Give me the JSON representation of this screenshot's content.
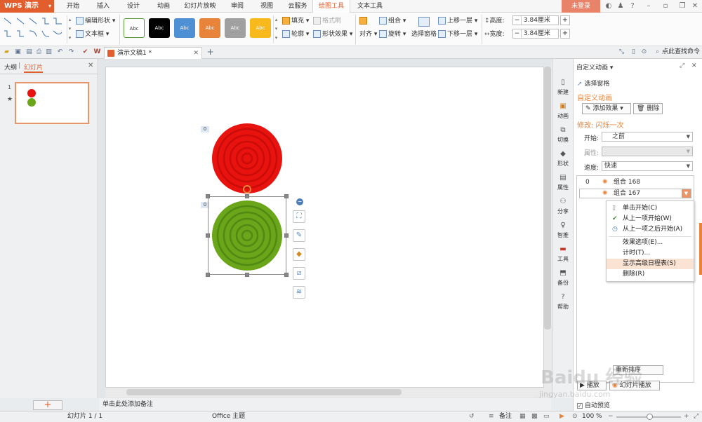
{
  "app": {
    "logo": "WPS 演示",
    "login": "未登录"
  },
  "menu_tabs": [
    "开始",
    "插入",
    "设计",
    "动画",
    "幻灯片放映",
    "审阅",
    "视图",
    "云服务",
    "绘图工具",
    "文本工具"
  ],
  "ribbon": {
    "edit_shape": "编辑形状",
    "textbox": "文本框",
    "style_label": "Abc",
    "fill": "填充",
    "format_brush": "格式刷",
    "outline": "轮廓",
    "shape_effect": "形状效果",
    "align": "对齐",
    "group": "组合",
    "rotate": "旋转",
    "selection_pane": "选择窗格",
    "bring_forward": "上移一层",
    "send_backward": "下移一层",
    "height_label": "高度:",
    "height_value": "3.84厘米",
    "width_label": "宽度:",
    "width_value": "3.84厘米",
    "swatch_colors": [
      "#ffffff",
      "#000000",
      "#4f8fd4",
      "#e8843a",
      "#a0a0a0",
      "#f7b91c"
    ]
  },
  "doc_tab": {
    "title": "演示文稿1 *"
  },
  "quick_right": {
    "search": "点此查找命令"
  },
  "left_pane": {
    "tab_outline": "大纲",
    "tab_slides": "幻灯片",
    "slide_number": "1"
  },
  "slide": {
    "shape_tags": [
      "0",
      "0"
    ],
    "red_circle_color": "#e8120f",
    "green_circle_color": "#6aa51a"
  },
  "notes": {
    "placeholder": "单击此处添加备注"
  },
  "icon_strip": [
    {
      "label": "新建",
      "icon": "doc-icon"
    },
    {
      "label": "动画",
      "icon": "animation-icon"
    },
    {
      "label": "切换",
      "icon": "switch-icon"
    },
    {
      "label": "形状",
      "icon": "shape-icon"
    },
    {
      "label": "属性",
      "icon": "property-icon"
    },
    {
      "label": "分享",
      "icon": "share-icon"
    },
    {
      "label": "智推",
      "icon": "bulb-icon"
    },
    {
      "label": "工具",
      "icon": "toolbox-icon"
    },
    {
      "label": "备份",
      "icon": "backup-icon"
    },
    {
      "label": "帮助",
      "icon": "help-icon"
    }
  ],
  "anim_panel": {
    "title": "自定义动画",
    "selection_pane": "选择窗格",
    "section": "自定义动画",
    "add_effect": "添加效果",
    "delete": "删除",
    "modify": "修改: 闪烁一次",
    "start_label": "开始:",
    "start_value": "之前",
    "property_label": "属性:",
    "speed_label": "速度:",
    "speed_value": "快速",
    "items": [
      {
        "index": "0",
        "name": "组合 168"
      },
      {
        "index": "",
        "name": "组合 167"
      }
    ],
    "reorder": "重新排序",
    "play": "播放",
    "slideshow": "幻灯片播放",
    "autopreview": "自动预览"
  },
  "context_menu": [
    {
      "label": "单击开始(C)",
      "mark": "mouse"
    },
    {
      "label": "从上一项开始(W)",
      "mark": "check"
    },
    {
      "label": "从上一项之后开始(A)",
      "mark": "clock"
    },
    {
      "label": "效果选项(E)...",
      "mark": ""
    },
    {
      "label": "计时(T)...",
      "mark": ""
    },
    {
      "label": "显示高级日程表(S)",
      "mark": ""
    },
    {
      "label": "删除(R)",
      "mark": ""
    }
  ],
  "status": {
    "slide_info": "幻灯片 1 / 1",
    "theme": "Office 主题",
    "notes": "备注",
    "zoom": "100 %"
  },
  "watermark": {
    "brand": "Baidu 经验",
    "url": "jingyan.baidu.com"
  }
}
